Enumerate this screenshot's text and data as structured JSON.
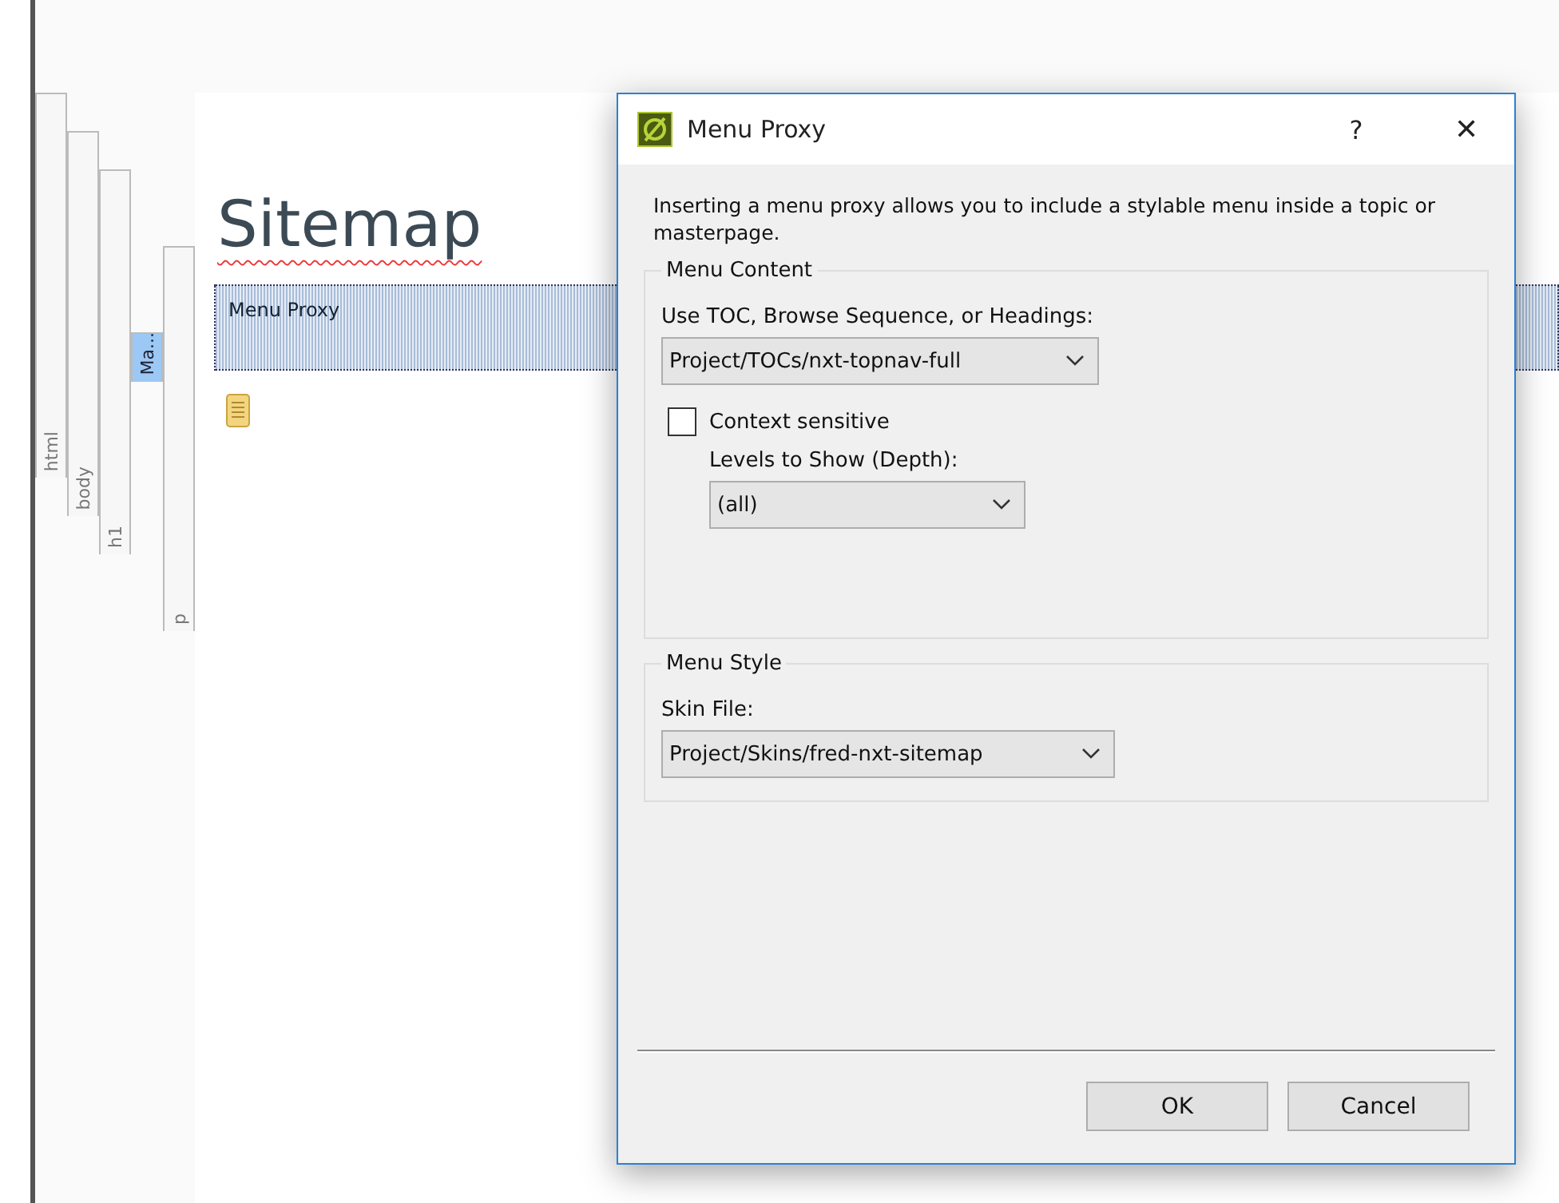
{
  "editor": {
    "structure_tags": [
      {
        "label": "html",
        "selected": false
      },
      {
        "label": "body",
        "selected": false
      },
      {
        "label": "h1",
        "selected": false
      },
      {
        "label": "Ma...",
        "selected": true
      },
      {
        "label": "p",
        "selected": false
      }
    ],
    "heading": "Sitemap",
    "proxy_label": "Menu Proxy"
  },
  "dialog": {
    "title": "Menu Proxy",
    "help": "?",
    "close": "✕",
    "description": "Inserting a menu proxy allows you to include a stylable menu inside a topic or masterpage.",
    "content_group": {
      "title": "Menu Content",
      "toc_label": "Use TOC, Browse Sequence, or Headings:",
      "toc_value": "Project/TOCs/nxt-topnav-full",
      "context_label": "Context sensitive",
      "context_checked": false,
      "levels_label": "Levels to Show (Depth):",
      "levels_value": "(all)"
    },
    "style_group": {
      "title": "Menu Style",
      "skin_label": "Skin File:",
      "skin_value": "Project/Skins/fred-nxt-sitemap"
    },
    "buttons": [
      "OK",
      "Cancel"
    ]
  }
}
